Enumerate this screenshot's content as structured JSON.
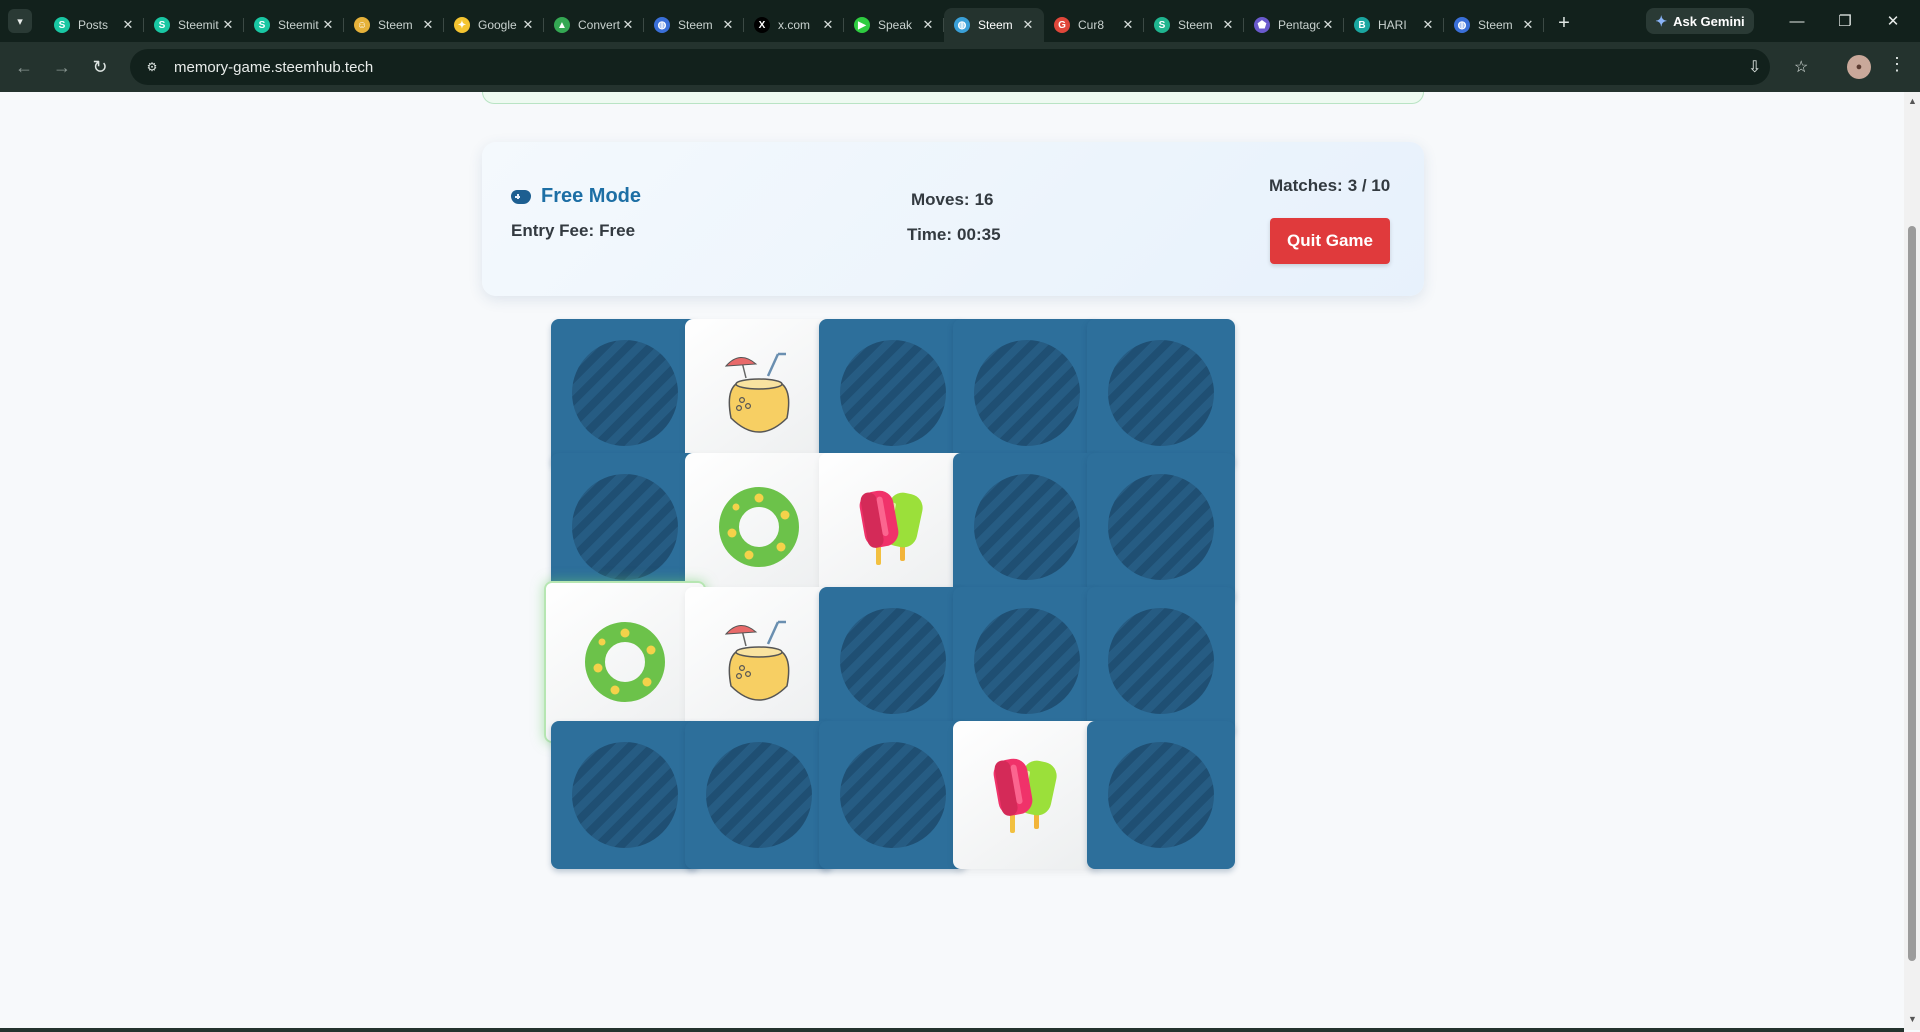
{
  "browser": {
    "tabs": [
      {
        "title": "Posts",
        "favicon": "steemit-logo-icon",
        "color": "#19c7a3"
      },
      {
        "title": "Steemit",
        "favicon": "steemit-logo-icon",
        "color": "#19c7a3"
      },
      {
        "title": "Steemit",
        "favicon": "steemit-logo-icon",
        "color": "#19c7a3"
      },
      {
        "title": "Steem",
        "favicon": "emoji-face-icon",
        "color": "#e6b23a"
      },
      {
        "title": "Google",
        "favicon": "lightbulb-icon",
        "color": "#f4c430"
      },
      {
        "title": "Converter",
        "favicon": "google-drive-icon",
        "color": "#34a853"
      },
      {
        "title": "Steem",
        "favicon": "globe-icon",
        "color": "#3a6fd8"
      },
      {
        "title": "x.com",
        "favicon": "x-logo-icon",
        "color": "#000000"
      },
      {
        "title": "Speak",
        "favicon": "play-icon",
        "color": "#2ecc40"
      },
      {
        "title": "Steem",
        "favicon": "globe-icon",
        "color": "#3aa0d8",
        "active": true
      },
      {
        "title": "Cur8",
        "favicon": "google-g-icon",
        "color": "#e0473a"
      },
      {
        "title": "Steem",
        "favicon": "steem-s-icon",
        "color": "#1fb58f"
      },
      {
        "title": "Pentagon",
        "favicon": "pentagon-icon",
        "color": "#6a5acd"
      },
      {
        "title": "HARI",
        "favicon": "b4-logo-icon",
        "color": "#1aa6a0"
      },
      {
        "title": "Steem",
        "favicon": "globe-icon",
        "color": "#3a6fd8"
      }
    ],
    "new_tab": "+",
    "ask_gemini": "Ask Gemini",
    "url": "memory-game.steemhub.tech"
  },
  "game": {
    "mode": "Free Mode",
    "entry_fee_label": "Entry Fee:",
    "entry_fee_value": "Free",
    "moves_label": "Moves:",
    "moves_value": "16",
    "time_label": "Time:",
    "time_value": "00:35",
    "matches_label": "Matches:",
    "matches_value": "3 / 10",
    "quit_label": "Quit Game"
  },
  "board": {
    "columns": 5,
    "rows": 4,
    "cards": [
      "back",
      "coconut-drink",
      "back",
      "back",
      "back",
      "back",
      "swim-ring",
      "popsicle",
      "back",
      "back",
      "swim-ring",
      "coconut-drink",
      "back",
      "back",
      "back",
      "back",
      "back",
      "back",
      "popsicle",
      "back"
    ],
    "selected_index": 10
  },
  "colors": {
    "card_back": "#2d6f9b",
    "mode_text": "#1d6fa5",
    "quit_button": "#e03a3c"
  }
}
